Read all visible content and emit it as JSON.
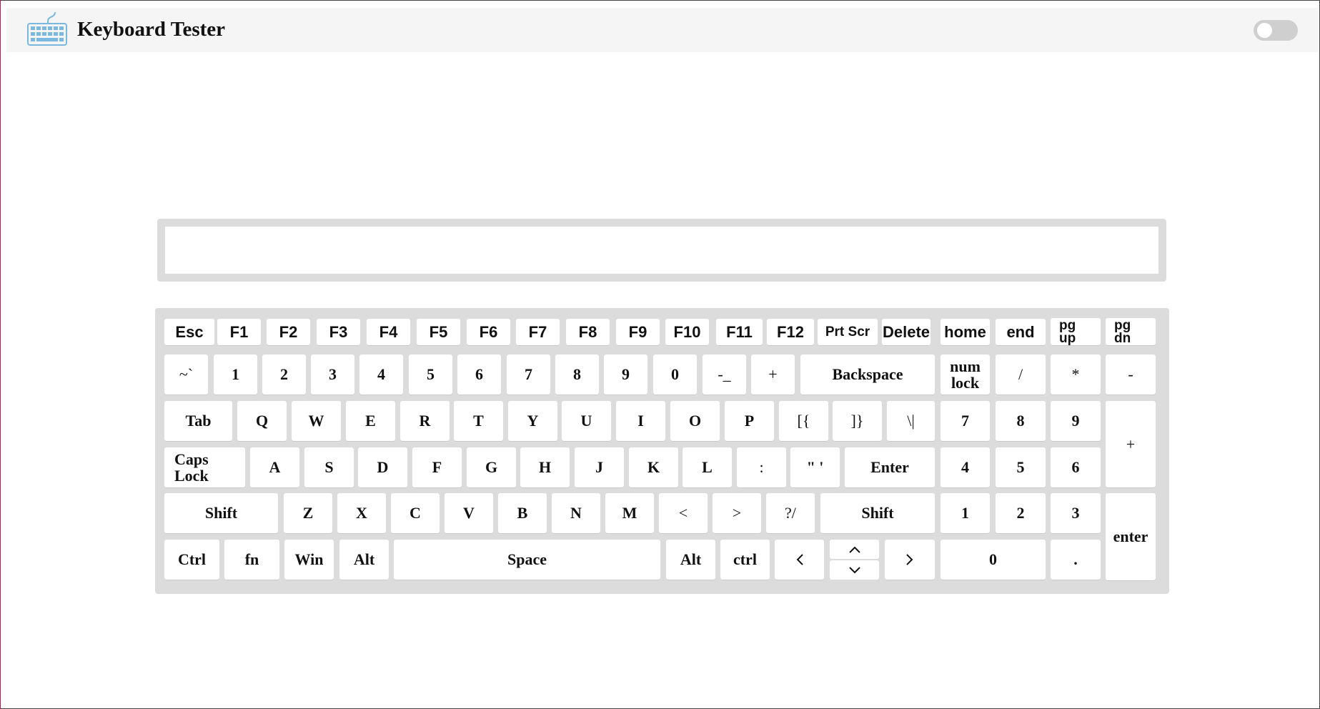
{
  "app": {
    "title": "Keyboard Tester",
    "logo_icon": "keyboard-icon",
    "theme_toggle_icon": "toggle-switch-icon",
    "accent_color": "#7ab8e0"
  },
  "display": {
    "value": ""
  },
  "keyboard": {
    "rows": [
      [
        {
          "label": "Esc",
          "name": "key-esc"
        },
        {
          "label": "F1",
          "name": "key-f1"
        },
        {
          "label": "F2",
          "name": "key-f2"
        },
        {
          "label": "F3",
          "name": "key-f3"
        },
        {
          "label": "F4",
          "name": "key-f4"
        },
        {
          "label": "F5",
          "name": "key-f5"
        },
        {
          "label": "F6",
          "name": "key-f6"
        },
        {
          "label": "F7",
          "name": "key-f7"
        },
        {
          "label": "F8",
          "name": "key-f8"
        },
        {
          "label": "F9",
          "name": "key-f9"
        },
        {
          "label": "F10",
          "name": "key-f10"
        },
        {
          "label": "F11",
          "name": "key-f11"
        },
        {
          "label": "F12",
          "name": "key-f12"
        },
        {
          "label": "Prt Scr",
          "name": "key-print-screen"
        },
        {
          "label": "Delete",
          "name": "key-delete"
        },
        {
          "label": "home",
          "name": "key-home"
        },
        {
          "label": "end",
          "name": "key-end"
        },
        {
          "label": "pg up",
          "name": "key-page-up"
        },
        {
          "label": "pg dn",
          "name": "key-page-down"
        }
      ],
      [
        {
          "label": "~`",
          "name": "key-tilde"
        },
        {
          "label": "1",
          "name": "key-1"
        },
        {
          "label": "2",
          "name": "key-2"
        },
        {
          "label": "3",
          "name": "key-3"
        },
        {
          "label": "4",
          "name": "key-4"
        },
        {
          "label": "5",
          "name": "key-5"
        },
        {
          "label": "6",
          "name": "key-6"
        },
        {
          "label": "7",
          "name": "key-7"
        },
        {
          "label": "8",
          "name": "key-8"
        },
        {
          "label": "9",
          "name": "key-9"
        },
        {
          "label": "0",
          "name": "key-0"
        },
        {
          "label": "-_",
          "name": "key-minus"
        },
        {
          "label": "+",
          "name": "key-plus"
        },
        {
          "label": "Backspace",
          "name": "key-backspace"
        },
        {
          "label": "num lock",
          "name": "key-num-lock"
        },
        {
          "label": "/",
          "name": "key-numpad-divide"
        },
        {
          "label": "*",
          "name": "key-numpad-multiply"
        },
        {
          "label": "-",
          "name": "key-numpad-minus"
        }
      ],
      [
        {
          "label": "Tab",
          "name": "key-tab"
        },
        {
          "label": "Q",
          "name": "key-q"
        },
        {
          "label": "W",
          "name": "key-w"
        },
        {
          "label": "E",
          "name": "key-e"
        },
        {
          "label": "R",
          "name": "key-r"
        },
        {
          "label": "T",
          "name": "key-t"
        },
        {
          "label": "Y",
          "name": "key-y"
        },
        {
          "label": "U",
          "name": "key-u"
        },
        {
          "label": "I",
          "name": "key-i"
        },
        {
          "label": "O",
          "name": "key-o"
        },
        {
          "label": "P",
          "name": "key-p"
        },
        {
          "label": "[{",
          "name": "key-bracket-left"
        },
        {
          "label": "]}",
          "name": "key-bracket-right"
        },
        {
          "label": "\\|",
          "name": "key-backslash"
        },
        {
          "label": "7",
          "name": "key-numpad-7"
        },
        {
          "label": "8",
          "name": "key-numpad-8"
        },
        {
          "label": "9",
          "name": "key-numpad-9"
        },
        {
          "label": "+",
          "name": "key-numpad-plus"
        }
      ],
      [
        {
          "label": "Caps Lock",
          "name": "key-caps-lock"
        },
        {
          "label": "A",
          "name": "key-a"
        },
        {
          "label": "S",
          "name": "key-s"
        },
        {
          "label": "D",
          "name": "key-d"
        },
        {
          "label": "F",
          "name": "key-f"
        },
        {
          "label": "G",
          "name": "key-g"
        },
        {
          "label": "H",
          "name": "key-h"
        },
        {
          "label": "J",
          "name": "key-j"
        },
        {
          "label": "K",
          "name": "key-k"
        },
        {
          "label": "L",
          "name": "key-l"
        },
        {
          "label": ":",
          "name": "key-semicolon"
        },
        {
          "label": "\" '",
          "name": "key-quote"
        },
        {
          "label": "Enter",
          "name": "key-enter"
        },
        {
          "label": "4",
          "name": "key-numpad-4"
        },
        {
          "label": "5",
          "name": "key-numpad-5"
        },
        {
          "label": "6",
          "name": "key-numpad-6"
        }
      ],
      [
        {
          "label": "Shift",
          "name": "key-shift-left"
        },
        {
          "label": "Z",
          "name": "key-z"
        },
        {
          "label": "X",
          "name": "key-x"
        },
        {
          "label": "C",
          "name": "key-c"
        },
        {
          "label": "V",
          "name": "key-v"
        },
        {
          "label": "B",
          "name": "key-b"
        },
        {
          "label": "N",
          "name": "key-n"
        },
        {
          "label": "M",
          "name": "key-m"
        },
        {
          "label": "<",
          "name": "key-comma"
        },
        {
          "label": ">",
          "name": "key-period"
        },
        {
          "label": "?/",
          "name": "key-slash"
        },
        {
          "label": "Shift",
          "name": "key-shift-right"
        },
        {
          "label": "1",
          "name": "key-numpad-1"
        },
        {
          "label": "2",
          "name": "key-numpad-2"
        },
        {
          "label": "3",
          "name": "key-numpad-3"
        },
        {
          "label": "enter",
          "name": "key-numpad-enter"
        }
      ],
      [
        {
          "label": "Ctrl",
          "name": "key-ctrl-left"
        },
        {
          "label": "fn",
          "name": "key-fn"
        },
        {
          "label": "Win",
          "name": "key-win"
        },
        {
          "label": "Alt",
          "name": "key-alt-left"
        },
        {
          "label": "Space",
          "name": "key-space"
        },
        {
          "label": "Alt",
          "name": "key-alt-right"
        },
        {
          "label": "ctrl",
          "name": "key-ctrl-right"
        },
        {
          "icon": "chevron-left-icon",
          "name": "key-arrow-left"
        },
        {
          "icon": "chevron-up-icon",
          "name": "key-arrow-up"
        },
        {
          "icon": "chevron-down-icon",
          "name": "key-arrow-down"
        },
        {
          "icon": "chevron-right-icon",
          "name": "key-arrow-right"
        },
        {
          "label": "0",
          "name": "key-numpad-0"
        },
        {
          "label": ".",
          "name": "key-numpad-decimal"
        }
      ]
    ]
  }
}
